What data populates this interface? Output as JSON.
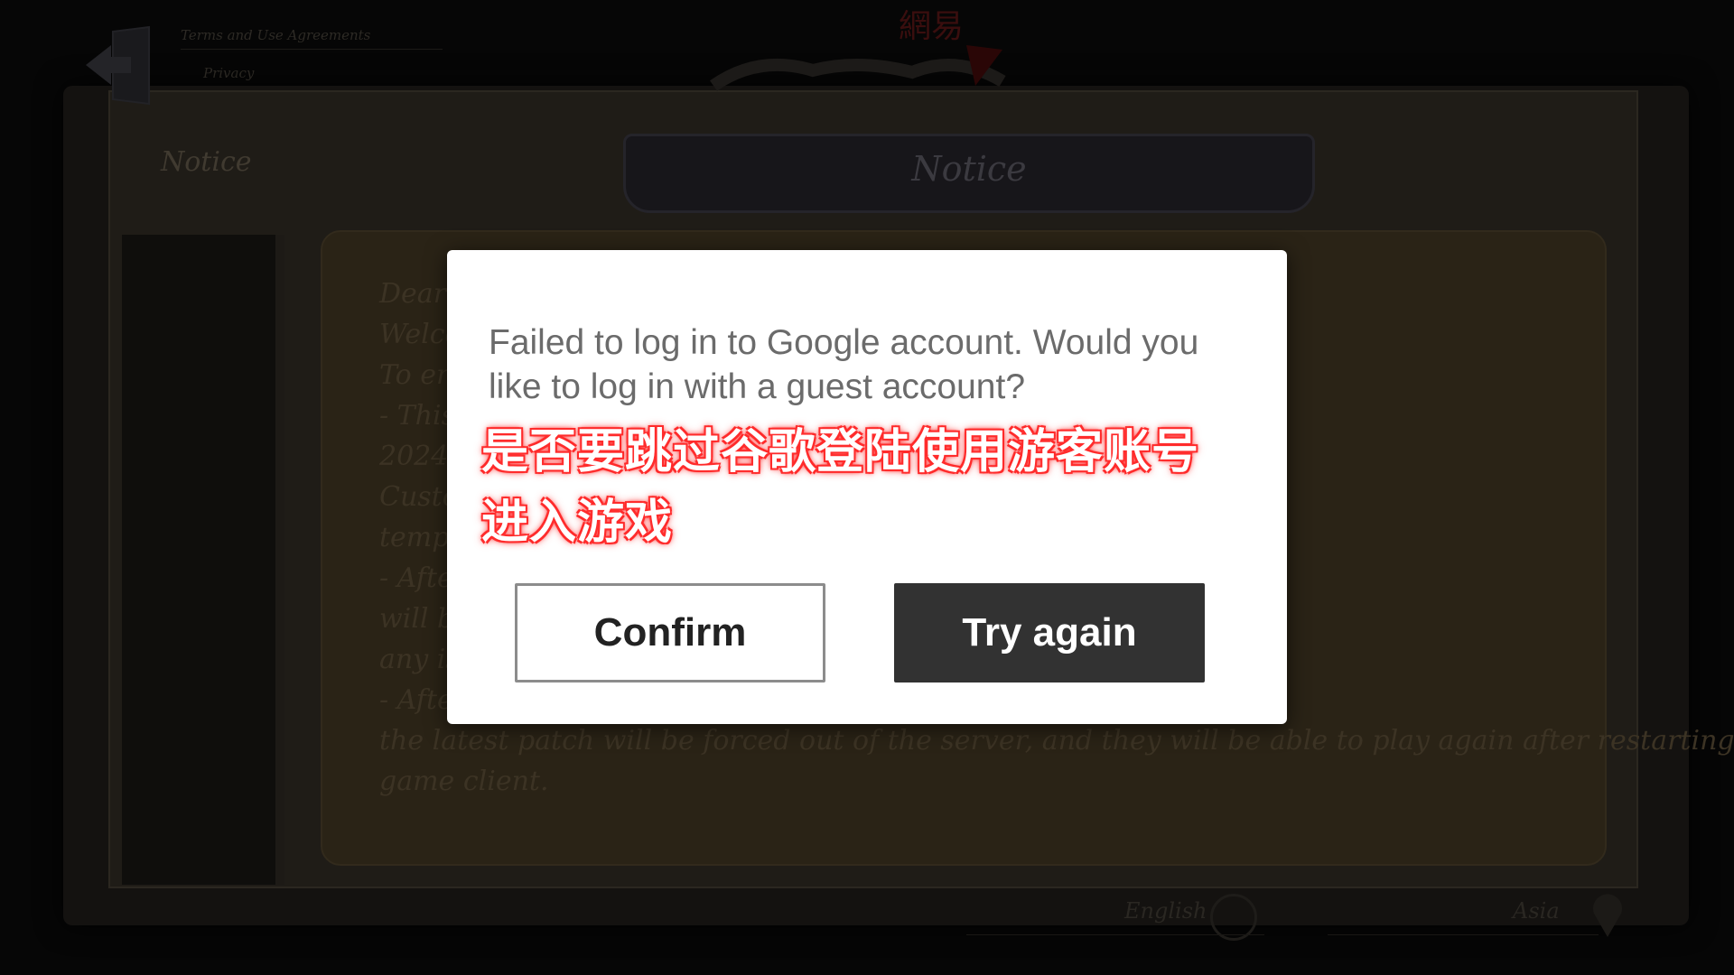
{
  "background": {
    "top_links": [
      "Terms and Use Agreements",
      "Privacy"
    ],
    "logo_text": "網易",
    "tab_label": "Notice",
    "banner_title": "Notice",
    "notice_lines": [
      "Dear u",
      "Welco",
      "To ens                                                                                                      UTC+8).",
      "- This                                                                                                  8:00 on May 16,",
      "2024 (                                                                                                 uding Quick Match,",
      "Custo                                                                                                  ill be closed",
      "tempo                                                                                                  l not be affected.)",
      "- Afte                                                                                                 ch. All game modes",
      "will be                                                                                                ent should there be",
      "any is",
      "- Afte                                                                                                 haven't installed",
      "the latest patch will be forced out of the server, and they will be able to play again after restarting the",
      "game client."
    ],
    "footer": {
      "language": "English",
      "region": "Asia"
    }
  },
  "dialog": {
    "message": "Failed to log in to Google account. Would you like to log in with a guest account?",
    "annotation_line1": "是否要跳过谷歌登陆使用游客账号",
    "annotation_line2": "进入游戏",
    "confirm_label": "Confirm",
    "retry_label": "Try again"
  },
  "colors": {
    "dialog_bg": "#ffffff",
    "message_text": "#6b6b6b",
    "annotation_text": "#ffffff",
    "annotation_glow": "#ff2a2a",
    "retry_bg": "#323232",
    "confirm_border": "#8c8c8c"
  }
}
